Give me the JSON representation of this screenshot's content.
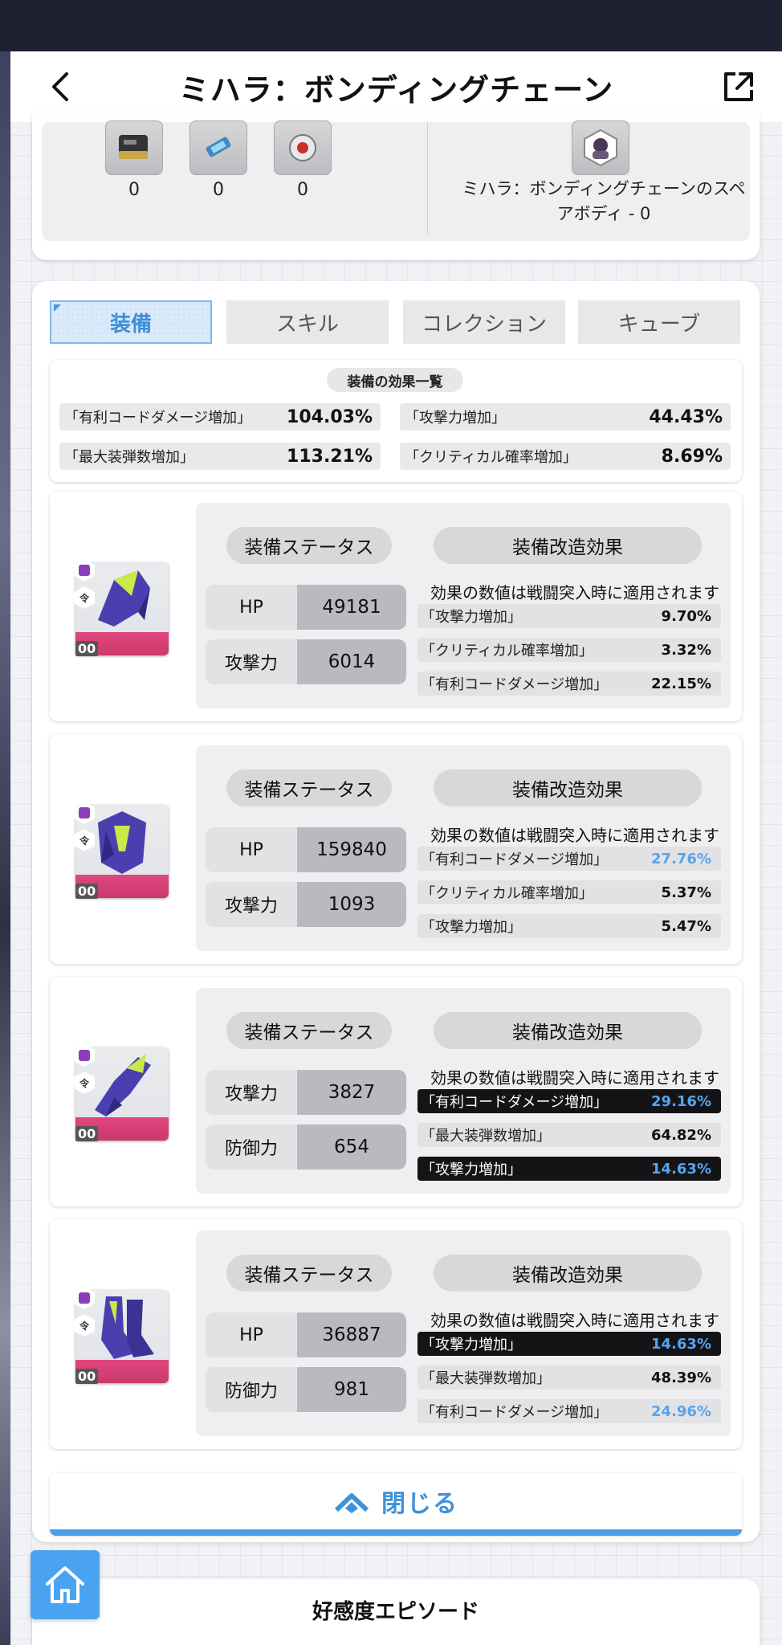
{
  "header": {
    "title": "ミハラ：ボンディングチェーン"
  },
  "items": {
    "counts": [
      "0",
      "0",
      "0"
    ],
    "spare_body_label_line1": "ミハラ：ボンディングチェーンのスペ",
    "spare_body_label_line2": "アボディ - 0"
  },
  "tabs": [
    "装備",
    "スキル",
    "コレクション",
    "キューブ"
  ],
  "active_tab": "装備",
  "summary": {
    "title": "装備の効果一覧",
    "rows": [
      {
        "label": "「有利コードダメージ増加」",
        "value": "104.03%"
      },
      {
        "label": "「攻撃力増加」",
        "value": "44.43%"
      },
      {
        "label": "「最大装弾数増加」",
        "value": "113.21%"
      },
      {
        "label": "「クリティカル確率増加」",
        "value": "8.69%"
      }
    ]
  },
  "equip_labels": {
    "status": "装備ステータス",
    "mod": "装備改造効果",
    "note": "効果の数値は戦闘突入時に適用されます",
    "badge_glyph": "令",
    "level": "00"
  },
  "equipment": [
    {
      "stats": [
        {
          "label": "HP",
          "value": "49181"
        },
        {
          "label": "攻撃力",
          "value": "6014"
        }
      ],
      "mods": [
        {
          "label": "「攻撃力増加」",
          "value": "9.70%"
        },
        {
          "label": "「クリティカル確率増加」",
          "value": "3.32%"
        },
        {
          "label": "「有利コードダメージ増加」",
          "value": "22.15%"
        }
      ]
    },
    {
      "stats": [
        {
          "label": "HP",
          "value": "159840"
        },
        {
          "label": "攻撃力",
          "value": "1093"
        }
      ],
      "mods": [
        {
          "label": "「有利コードダメージ増加」",
          "value": "27.76%"
        },
        {
          "label": "「クリティカル確率増加」",
          "value": "5.37%"
        },
        {
          "label": "「攻撃力増加」",
          "value": "5.47%"
        }
      ]
    },
    {
      "stats": [
        {
          "label": "攻撃力",
          "value": "3827"
        },
        {
          "label": "防御力",
          "value": "654"
        }
      ],
      "mods": [
        {
          "label": "「有利コードダメージ増加」",
          "value": "29.16%"
        },
        {
          "label": "「最大装弾数増加」",
          "value": "64.82%"
        },
        {
          "label": "「攻撃力増加」",
          "value": "14.63%"
        }
      ]
    },
    {
      "stats": [
        {
          "label": "HP",
          "value": "36887"
        },
        {
          "label": "防御力",
          "value": "981"
        }
      ],
      "mods": [
        {
          "label": "「攻撃力増加」",
          "value": "14.63%"
        },
        {
          "label": "「最大装弾数増加」",
          "value": "48.39%"
        },
        {
          "label": "「有利コードダメージ増加」",
          "value": "24.96%"
        }
      ]
    }
  ],
  "close_button": {
    "label": "閉じる"
  },
  "episode": {
    "title": "好感度エピソード"
  },
  "colors": {
    "accent": "#4b9ee6",
    "highlight_value": "#57a4ec",
    "dark_row": "#141416",
    "brand_pink": "#e0467e"
  },
  "icons": [
    "back-arrow-icon",
    "share-icon",
    "chevron-up-icon",
    "home-icon"
  ]
}
